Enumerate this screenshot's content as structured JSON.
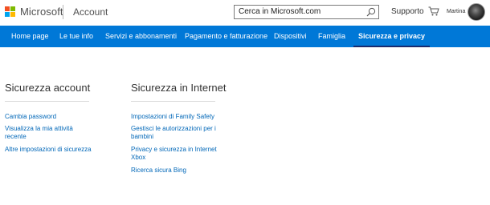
{
  "header": {
    "brand": "Microsoft",
    "section": "Account",
    "search_value": "Cerca in Microsoft.com",
    "support_label": "Supporto",
    "user_name": "Martina",
    "logo_colors": [
      "#f25022",
      "#7fba00",
      "#00a4ef",
      "#ffb900"
    ]
  },
  "nav": {
    "items": [
      {
        "label": "Home page"
      },
      {
        "label": "Le tue info"
      },
      {
        "label": "Servizi e abbonamenti"
      },
      {
        "label": "Pagamento e fatturazione"
      },
      {
        "label": "Dispositivi"
      },
      {
        "label": "Famiglia"
      },
      {
        "label": "Sicurezza e privacy"
      }
    ],
    "active": "Sicurezza e privacy"
  },
  "account_security": {
    "title": "Sicurezza account",
    "links": [
      {
        "label": "Cambia password"
      },
      {
        "label": "Visualizza la mia attività recente"
      },
      {
        "label": "Altre impostazioni di sicurezza"
      }
    ]
  },
  "internet_security": {
    "title": "Sicurezza in Internet",
    "links": [
      {
        "label": "Impostazioni di Family Safety"
      },
      {
        "label": "Gestisci le autorizzazioni per i bambini"
      },
      {
        "label": "Privacy e sicurezza in Internet Xbox"
      },
      {
        "label": "Ricerca sicura Bing"
      }
    ]
  },
  "colors": {
    "nav_bg": "#0078d7",
    "active_underline": "#1a2b6e",
    "link": "#0067b8"
  }
}
